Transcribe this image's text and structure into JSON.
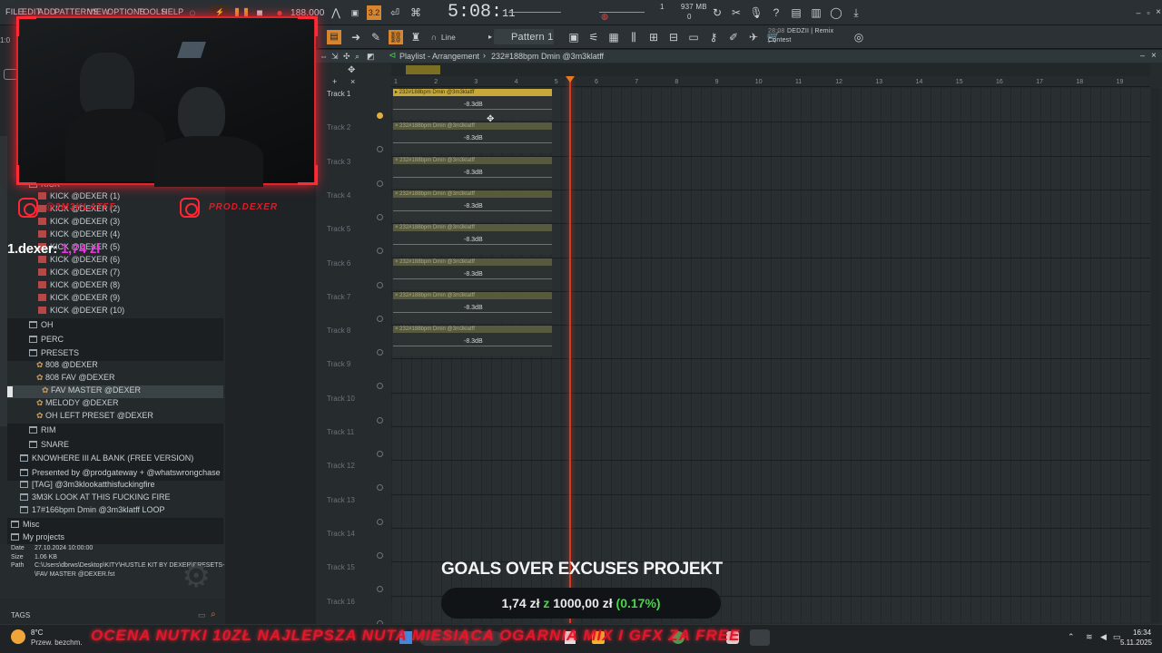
{
  "menubar": {
    "items": [
      "FILE",
      "EDIT",
      "ADD",
      "PATTERNS",
      "VIEW",
      "OPTIONS",
      "TOOLS",
      "HELP"
    ],
    "bpm": "188.000",
    "time_main": "5:08:",
    "time_sub": "11",
    "memory": "937 MB",
    "memory_sub": "0",
    "cpu_num": "1"
  },
  "toolbar2": {
    "snap_label": "Line",
    "pattern_label": "Pattern 1",
    "news_time": "28:08",
    "news_line1": "DEDZII | Remix",
    "news_line2": "Contest"
  },
  "playlist": {
    "title": "Playlist - Arrangement",
    "breadcrumb": "232#188bpm Dmin @3m3klatff",
    "ruler": [
      "1",
      "2",
      "3",
      "4",
      "5",
      "6",
      "7",
      "8",
      "9",
      "10",
      "11",
      "12",
      "13",
      "14",
      "15",
      "16",
      "17",
      "18",
      "19"
    ],
    "tracks": [
      "Track 1",
      "Track 2",
      "Track 3",
      "Track 4",
      "Track 5",
      "Track 6",
      "Track 7",
      "Track 8",
      "Track 9",
      "Track 10",
      "Track 11",
      "Track 12",
      "Track 13",
      "Track 14",
      "Track 15",
      "Track 16"
    ],
    "clip_name": "232#188bpm Dmin @3m3klatff",
    "clip_db": "-8.3dB"
  },
  "browser": {
    "kick_folder": "KICK",
    "kicks": [
      "KICK @DEXER (1)",
      "KICK @DEXER (2)",
      "KICK @DEXER (3)",
      "KICK @DEXER (4)",
      "KICK @DEXER (5)",
      "KICK @DEXER (6)",
      "KICK @DEXER (7)",
      "KICK @DEXER (8)",
      "KICK @DEXER (9)",
      "KICK @DEXER (10)"
    ],
    "oh": "OH",
    "perc": "PERC",
    "presets": "PRESETS",
    "preset_items": [
      "808 @DEXER",
      "808 FAV @DEXER",
      "FAV MASTER @DEXER",
      "MELODY @DEXER",
      "OH LEFT PRESET @DEXER"
    ],
    "rim": "RIM",
    "snare": "SNARE",
    "knowhere": "KNOWHERE III AL BANK (FREE VERSION)",
    "presented": "Presented by @prodgateway + @whatswrongchase",
    "tag_file": "[TAG] @3m3klookatthisfuckingfire",
    "look_file": "3M3K LOOK AT THIS FUCKING FIRE",
    "loop_file": "17#166bpm Dmin @3m3klatff LOOP",
    "misc": "Misc",
    "projects": "My projects",
    "info": {
      "date_label": "Date",
      "date": "27.10.2024 10:00:00",
      "size_label": "Size",
      "size": "1.06 KB",
      "path_label": "Path",
      "path1": "C:\\Users\\dbrws\\Desktop\\KITY\\HUSTLE KIT BY DEXER\\PRESETS-",
      "path2": "\\FAV MASTER @DEXER.fst"
    },
    "tags": "TAGS"
  },
  "overlay": {
    "donor": "1.dexer:",
    "donor_amount": "1,74 zł",
    "ig1": "@3M3KLATFF",
    "ig2": "PROD.DEXER",
    "goal_title": "GOALS OVER EXCUSES PROJEKT",
    "goal_current": "1,74 zł",
    "goal_of": "z",
    "goal_target": "1000,00 zł",
    "goal_pct": "(0.17%)"
  },
  "taskbar": {
    "temp": "8°C",
    "weather": "Przew. bezchm.",
    "ticker": "OCENA NUTKI 10ZŁ   NAJLEPSZA NUTA MIESIĄCA   OGARNIA MIX I GFX ZA FREE",
    "time": "16:34",
    "date": "5.11.2025"
  }
}
